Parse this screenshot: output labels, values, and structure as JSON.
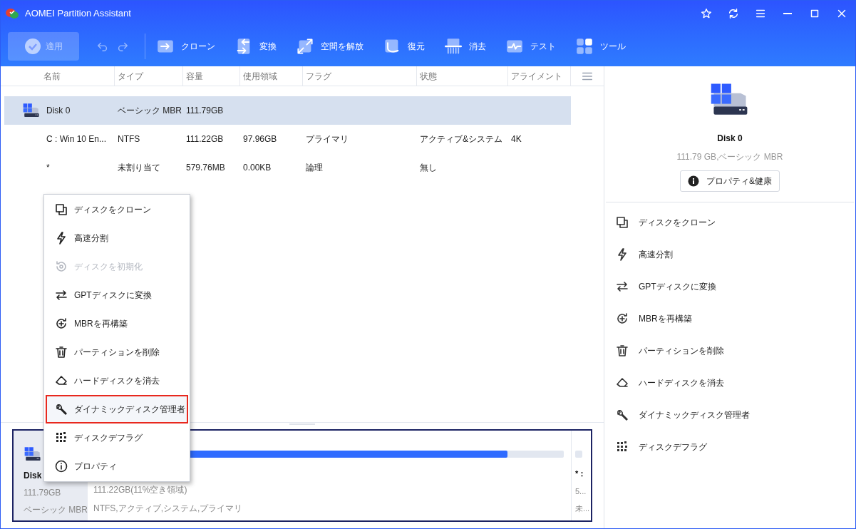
{
  "window": {
    "title": "AOMEI Partition Assistant"
  },
  "toolbar": {
    "apply": {
      "label": "適用",
      "disabled": true
    },
    "tools": [
      {
        "label": "クローン"
      },
      {
        "label": "変換"
      },
      {
        "label": "空間を解放"
      },
      {
        "label": "復元"
      },
      {
        "label": "消去"
      },
      {
        "label": "テスト"
      },
      {
        "label": "ツール"
      }
    ]
  },
  "table": {
    "columns": [
      "名前",
      "タイプ",
      "容量",
      "使用領域",
      "フラグ",
      "状態",
      "アライメント"
    ],
    "rows": [
      {
        "kind": "disk",
        "selected": true,
        "cells": [
          "Disk 0",
          "ベーシック MBR",
          "111.79GB",
          "",
          "",
          "",
          ""
        ]
      },
      {
        "kind": "partition",
        "selected": false,
        "cells": [
          "C : Win 10 En...",
          "NTFS",
          "111.22GB",
          "97.96GB",
          "プライマリ",
          "アクティブ&システム",
          "4K"
        ]
      },
      {
        "kind": "partition",
        "selected": false,
        "cells": [
          "*",
          "未割り当て",
          "579.76MB",
          "0.00KB",
          "論理",
          "無し",
          ""
        ]
      }
    ]
  },
  "context_menu": [
    {
      "label": "ディスクをクローン",
      "disabled": false,
      "highlighted": false
    },
    {
      "label": "高速分割",
      "disabled": false,
      "highlighted": false
    },
    {
      "label": "ディスクを初期化",
      "disabled": true,
      "highlighted": false
    },
    {
      "label": "GPTディスクに変換",
      "disabled": false,
      "highlighted": false
    },
    {
      "label": "MBRを再構築",
      "disabled": false,
      "highlighted": false
    },
    {
      "label": "パーティションを削除",
      "disabled": false,
      "highlighted": false
    },
    {
      "label": "ハードディスクを消去",
      "disabled": false,
      "highlighted": false
    },
    {
      "label": "ダイナミックディスク管理者",
      "disabled": false,
      "highlighted": true
    },
    {
      "label": "ディスクデフラグ",
      "disabled": false,
      "highlighted": false
    },
    {
      "label": "プロパティ",
      "disabled": false,
      "highlighted": false
    }
  ],
  "disk_map": {
    "label": "Disk",
    "size": "111.79GB",
    "type": "ベーシック MBR",
    "partitions": [
      {
        "level": 0.88,
        "lines": [
          "111.22GB(11%空き領域)",
          "NTFS,アクティブ,システム,プライマリ"
        ]
      },
      {
        "name": "*：",
        "lines": [
          "5...",
          "未..."
        ]
      }
    ]
  },
  "right_panel": {
    "disk_name": "Disk 0",
    "disk_info": "111.79 GB,ベーシック MBR",
    "button": "プロパティ&健康",
    "actions": [
      "ディスクをクローン",
      "高速分割",
      "GPTディスクに変換",
      "MBRを再構築",
      "パーティションを削除",
      "ハードディスクを消去",
      "ダイナミックディスク管理者",
      "ディスクデフラグ"
    ]
  }
}
